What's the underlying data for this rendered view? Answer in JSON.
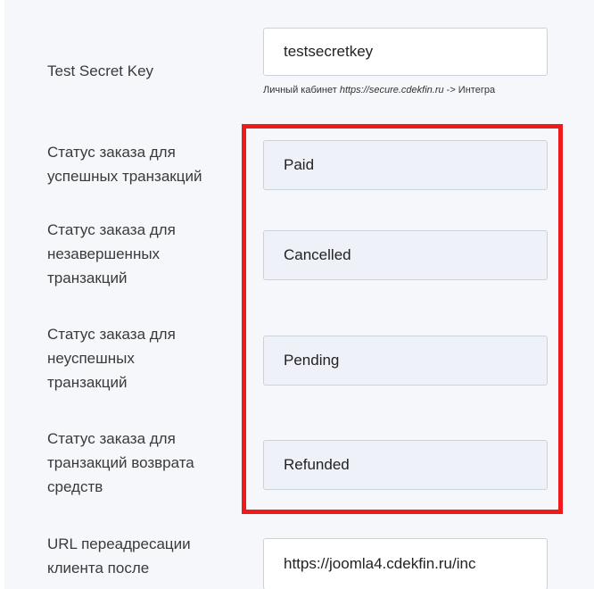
{
  "fields": {
    "test_secret_key": {
      "label": "Test Secret Key",
      "value": "testsecretkey",
      "hint_prefix": "Личный кабинет ",
      "hint_url": "https://secure.cdekfin.ru",
      "hint_suffix": " -> Интегра"
    },
    "status_success": {
      "label": "Статус заказа для\nуспешных транзакций",
      "value": "Paid"
    },
    "status_incomplete": {
      "label": "Статус заказа для\nнезавершенных\nтранзакций",
      "value": "Cancelled"
    },
    "status_failed": {
      "label": "Статус заказа для\nнеуспешных\nтранзакций",
      "value": "Pending"
    },
    "status_refund": {
      "label": "Статус заказа для\nтранзакций возврата\nсредств",
      "value": "Refunded"
    },
    "redirect_url": {
      "label": "URL переадресации\nклиента после",
      "value": "https://joomla4.cdekfin.ru/inc"
    }
  },
  "colors": {
    "highlight": "#ef1a1a",
    "panel_bg": "#f5f7fa",
    "select_bg": "#eef1f8"
  }
}
